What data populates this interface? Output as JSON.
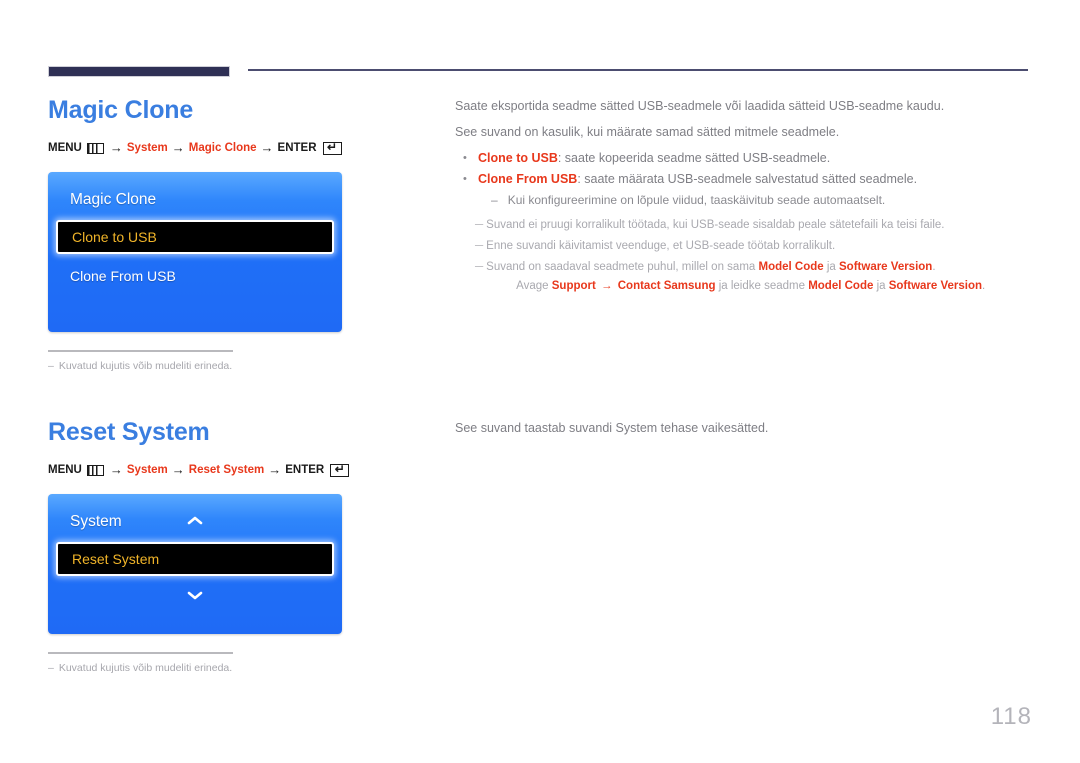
{
  "document": {
    "page_number": "118",
    "accent_blue": "#3a7ee0",
    "accent_red": "#e8381c",
    "osd_blue": "#1f6ff7",
    "highlight_text": "#f0b429"
  },
  "sections": [
    {
      "title": "Magic Clone",
      "menu_path": {
        "menu_label": "MENU",
        "menu_icon": "menu-bars-icon",
        "arrow": "→",
        "step1": "System",
        "step2": "Magic Clone",
        "enter_label": "ENTER",
        "enter_icon": "enter-key-icon"
      },
      "osd": {
        "title": "Magic Clone",
        "show_up_chevron": false,
        "show_down_chevron": false,
        "rows": [
          {
            "label": "Clone to USB",
            "selected": true
          },
          {
            "label": "Clone From USB",
            "selected": false
          }
        ]
      },
      "caption": {
        "dash": "–",
        "text": "Kuvatud kujutis võib mudeliti erineda."
      },
      "body": {
        "paragraphs": [
          "Saate eksportida seadme sätted USB-seadmele või laadida sätteid USB-seadme kaudu.",
          "See suvand on kasulik, kui määrate samad sätted mitmele seadmele."
        ],
        "bullets": [
          {
            "bullet": "•",
            "term": "Clone to USB",
            "text": ": saate kopeerida seadme sätted USB-seadmele."
          },
          {
            "bullet": "•",
            "term": "Clone From USB",
            "text": ": saate määrata USB-seadmele salvestatud sätted seadmele."
          }
        ],
        "subdash": {
          "dash": "–",
          "text": "Kui konfigureerimine on lõpule viidud, taaskäivitub seade automaatselt."
        },
        "notes": [
          {
            "dash": "─",
            "parts": [
              {
                "t": "Suvand ei pruugi korralikult töötada, kui USB-seade sisaldab peale sätetefaili ka teisi faile.",
                "bold": false
              }
            ]
          },
          {
            "dash": "─",
            "parts": [
              {
                "t": "Enne suvandi käivitamist veenduge, et USB-seade töötab korralikult.",
                "bold": false
              }
            ]
          },
          {
            "dash": "─",
            "parts": [
              {
                "t": "Suvand on saadaval seadmete puhul, millel on sama ",
                "bold": false
              },
              {
                "t": "Model Code",
                "bold": true
              },
              {
                "t": " ja ",
                "bold": false
              },
              {
                "t": "Software Version",
                "bold": true
              },
              {
                "t": ".",
                "bold": false
              }
            ],
            "continuation": [
              {
                "t": "Avage ",
                "bold": false
              },
              {
                "t": "Support",
                "bold": true
              },
              {
                "t": " → ",
                "bold": true,
                "arrow": true
              },
              {
                "t": "Contact Samsung",
                "bold": true
              },
              {
                "t": " ja leidke seadme ",
                "bold": false
              },
              {
                "t": "Model Code",
                "bold": true
              },
              {
                "t": " ja ",
                "bold": false
              },
              {
                "t": "Software Version",
                "bold": true
              },
              {
                "t": ".",
                "bold": false
              }
            ]
          }
        ]
      }
    },
    {
      "title": "Reset System",
      "menu_path": {
        "menu_label": "MENU",
        "menu_icon": "menu-bars-icon",
        "arrow": "→",
        "step1": "System",
        "step2": "Reset System",
        "enter_label": "ENTER",
        "enter_icon": "enter-key-icon"
      },
      "osd": {
        "title": "System",
        "show_up_chevron": true,
        "show_down_chevron": true,
        "rows": [
          {
            "label": "Reset System",
            "selected": true
          }
        ]
      },
      "caption": {
        "dash": "–",
        "text": "Kuvatud kujutis võib mudeliti erineda."
      },
      "body": {
        "paragraphs": [
          "See suvand taastab suvandi System tehase vaikesätted."
        ],
        "bullets": [],
        "subdash": null,
        "notes": []
      }
    }
  ]
}
